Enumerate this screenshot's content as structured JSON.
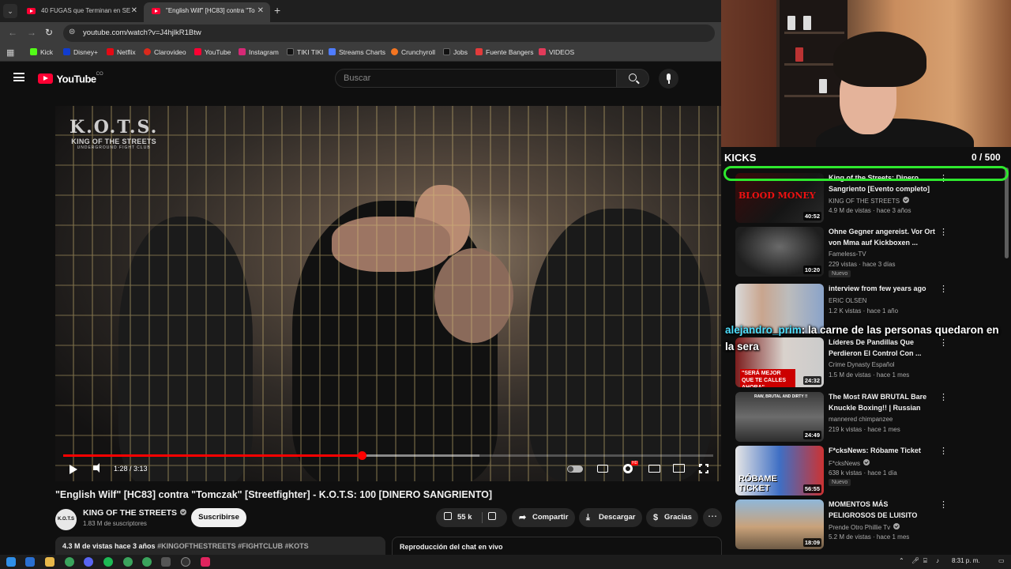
{
  "browser": {
    "tabs": [
      {
        "title": "40 FUGAS que Terminan en SE"
      },
      {
        "title": "\"English Wilf\" [HC83] contra \"To"
      }
    ],
    "url": "youtube.com/watch?v=J4hjlkR1Btw",
    "bookmarks": [
      {
        "label": "Kick",
        "color": "#53fc18"
      },
      {
        "label": "Disney+",
        "color": "#113ccf"
      },
      {
        "label": "Netflix",
        "color": "#e50914"
      },
      {
        "label": "Clarovideo",
        "color": "#da291c"
      },
      {
        "label": "YouTube",
        "color": "#ff0033"
      },
      {
        "label": "Instagram",
        "color": "#d62976"
      },
      {
        "label": "TIKI TIKI",
        "color": "#111111"
      },
      {
        "label": "Streams Charts",
        "color": "#4f7cff"
      },
      {
        "label": "Crunchyroll",
        "color": "#f47521"
      },
      {
        "label": "Jobs",
        "color": "#111111"
      },
      {
        "label": "Fuente Bangers",
        "color": "#e23b3b"
      },
      {
        "label": "VIDEOS",
        "color": "#e23b5a"
      }
    ]
  },
  "youtube": {
    "logo_text": "YouTube",
    "country_code": "CO",
    "search_placeholder": "Buscar"
  },
  "player": {
    "watermark": {
      "line1": "K.O.T.S.",
      "line2": "KING OF THE STREETS",
      "line3": "UNDERGROUND FIGHT CLUB"
    },
    "time": "1:28 / 3:13",
    "progress_fraction": 0.459,
    "buffered_fraction": 0.64,
    "hd_badge": "HD"
  },
  "video": {
    "title": "\"English Wilf\" [HC83] contra \"Tomczak\" [Streetfighter] - K.O.T.S: 100 [DINERO SANGRIENTO]",
    "channel_avatar_text": "K.O.T.S",
    "channel_name": "KING OF THE STREETS",
    "subscribers": "1.83 M de suscriptores",
    "subscribe_label": "Suscribirse",
    "likes": "55 k",
    "share_label": "Compartir",
    "download_label": "Descargar",
    "thanks_label": "Gracias",
    "views_age": "4.3 M de vistas  hace 3 años",
    "hashtags": "#KINGOFTHESTREETS #FIGHTCLUB #KOTS",
    "chat_replay_label": "Reproducción del chat en vivo"
  },
  "overlay": {
    "kicks_label": "KICKS",
    "kicks_count": "0 / 500",
    "chat_user": "alejandro_prim",
    "chat_message": "la carne de las personas quedaron en la sera",
    "colors": {
      "highlight": "#2ee82e",
      "chat_user": "#4fe0ff"
    }
  },
  "recommendations": [
    {
      "title": "King of the Streets: Dinero Sangriento [Evento completo]",
      "channel": "KING OF THE STREETS",
      "verified": true,
      "views": "4.9 M de vistas · hace 3 años",
      "duration": "40:52",
      "badge": "",
      "thumb_text": "BLOOD MONEY"
    },
    {
      "title": "Ohne Gegner angereist. Vor Ort von Mma auf Kickboxen ...",
      "channel": "Fameless-TV",
      "verified": false,
      "views": "229 vistas · hace 3 días",
      "duration": "10:20",
      "badge": "Nuevo",
      "thumb_text": ""
    },
    {
      "title": "interview from few years ago",
      "channel": "ERIC OLSEN",
      "verified": false,
      "views": "1.2 K vistas · hace 1 año",
      "duration": "",
      "badge": "",
      "thumb_text": ""
    },
    {
      "title": "Líderes De Pandillas Que Perdieron El Control Con ...",
      "channel": "Crime Dynasty Español",
      "verified": false,
      "views": "1.5 M de vistas · hace 1 mes",
      "duration": "24:32",
      "badge": "",
      "thumb_text": "\"SERÁ MEJOR QUE TE CALLES AHORA\""
    },
    {
      "title": "The Most RAW BRUTAL Bare Knuckle Boxing!! | Russian Bar...",
      "channel": "mannered chimpanzee",
      "verified": false,
      "views": "219 k vistas · hace 1 mes",
      "duration": "24:49",
      "badge": "",
      "thumb_text": "RAW, BRUTAL AND DIRTY !!"
    },
    {
      "title": "F*cksNews: Róbame Ticket",
      "channel": "F*cksNews",
      "verified": true,
      "views": "638 k vistas · hace 1 día",
      "duration": "56:55",
      "badge": "Nuevo",
      "thumb_text": "RÓBAME TICKET"
    },
    {
      "title": "MOMENTOS MÁS PELIGROSOS DE LUISITO COMUNICA",
      "channel": "Prende Otro Phillie Tv",
      "verified": true,
      "views": "5.2 M de vistas · hace 1 mes",
      "duration": "18:09",
      "badge": "",
      "thumb_text": ""
    }
  ],
  "taskbar": {
    "clock": "8:31 p. m."
  }
}
